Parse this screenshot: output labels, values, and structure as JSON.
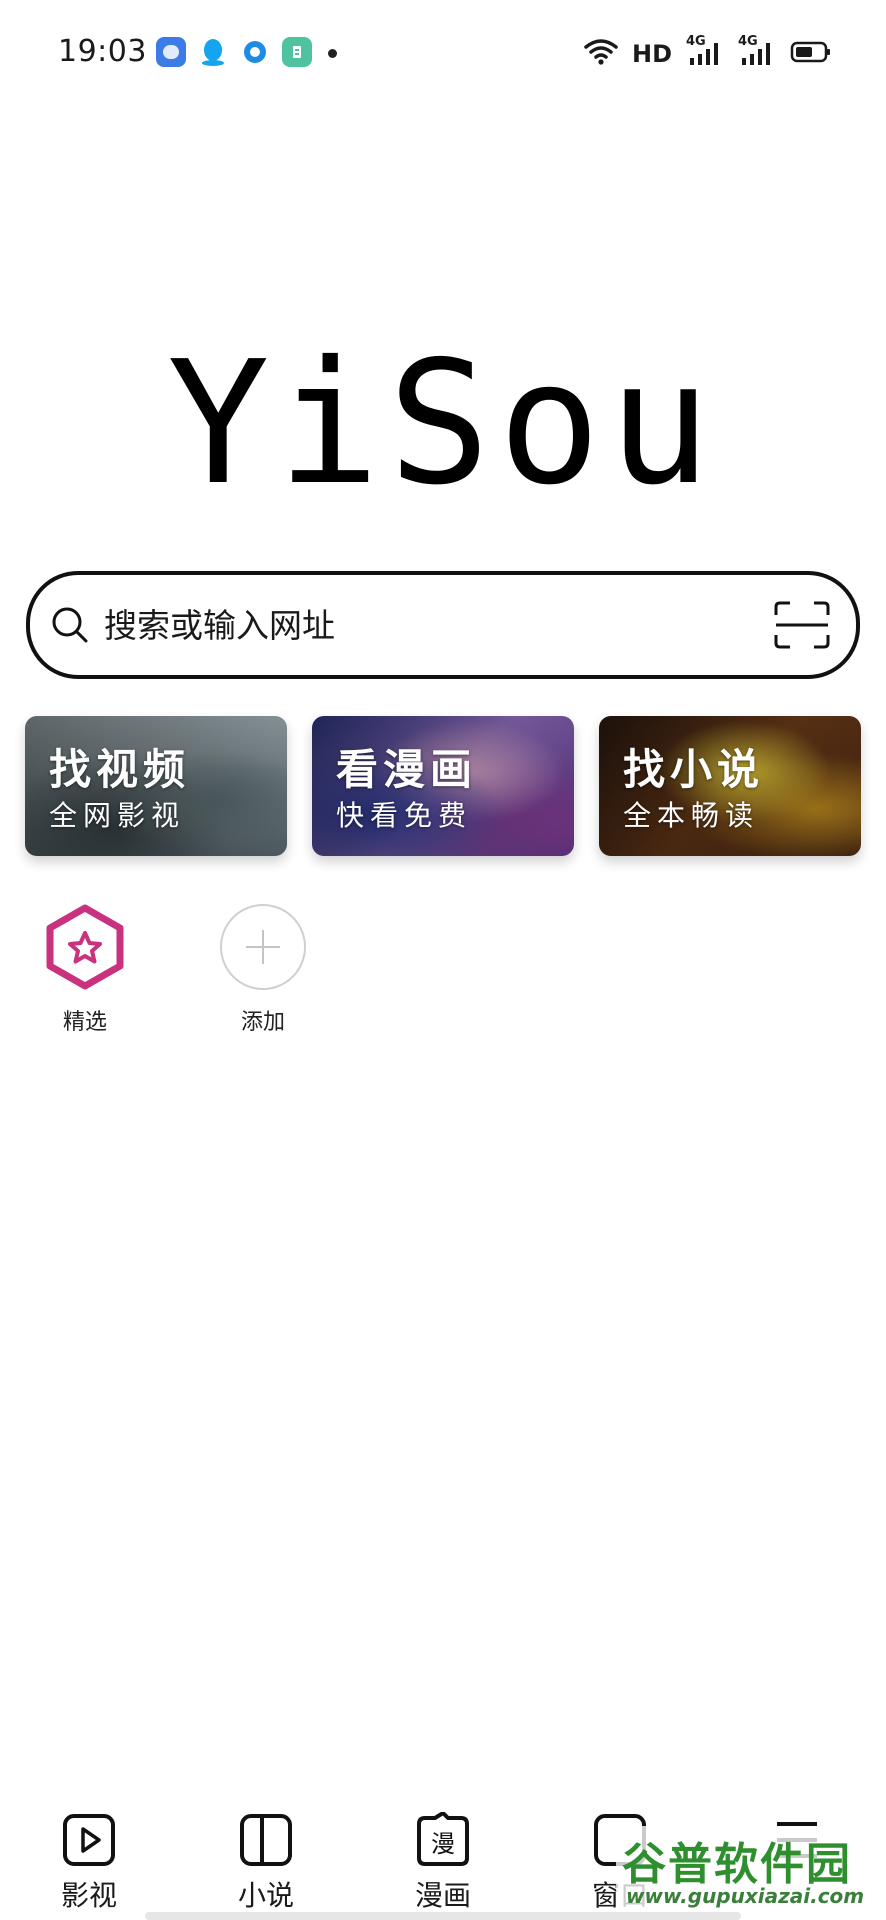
{
  "status_bar": {
    "time": "19:03",
    "app_icons": [
      "cloud-app-icon",
      "qq-icon",
      "circle-app-icon",
      "green-app-icon"
    ],
    "hd_label": "HD",
    "network_1": "4G",
    "network_2": "4G",
    "icons": [
      "wifi-icon",
      "signal-icon",
      "battery-icon"
    ]
  },
  "logo": {
    "text": "YiSou"
  },
  "search": {
    "placeholder": "搜索或输入网址"
  },
  "cards": [
    {
      "title": "找视频",
      "subtitle": "全网影视"
    },
    {
      "title": "看漫画",
      "subtitle": "快看免费"
    },
    {
      "title": "找小说",
      "subtitle": "全本畅读"
    }
  ],
  "shortcuts": [
    {
      "label": "精选",
      "icon": "star-hexagon-icon"
    },
    {
      "label": "添加",
      "icon": "plus-icon"
    }
  ],
  "bottom_nav": [
    {
      "label": "影视",
      "icon": "play-icon"
    },
    {
      "label": "小说",
      "icon": "book-icon"
    },
    {
      "label": "漫画",
      "icon": "comic-icon",
      "glyph": "漫"
    },
    {
      "label": "窗口",
      "icon": "window-icon"
    },
    {
      "label": "",
      "icon": "menu-icon"
    }
  ],
  "watermark": {
    "title": "谷普软件园",
    "url": "www.gupuxiazai.com"
  },
  "colors": {
    "accent": "#c8327e",
    "text": "#111111",
    "background": "#ffffff",
    "watermark": "#2f8f2f"
  }
}
